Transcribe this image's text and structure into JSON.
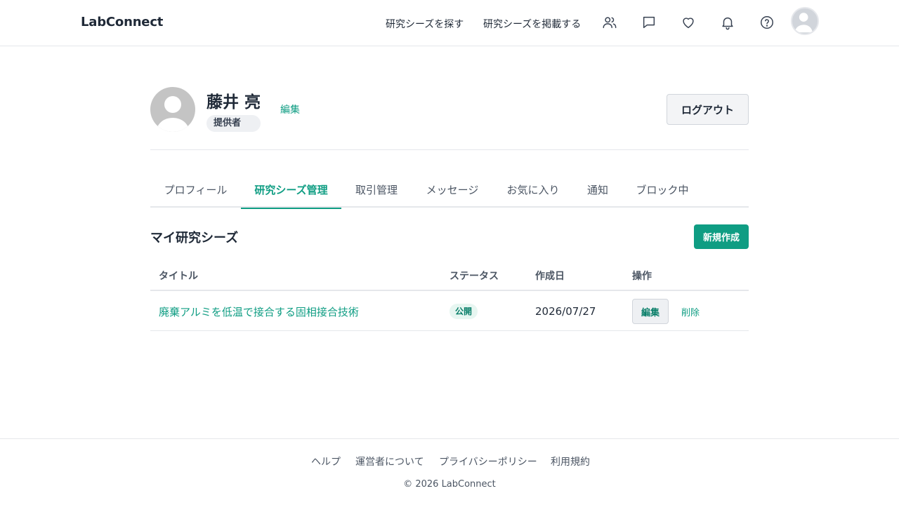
{
  "header": {
    "brand": "LabConnect",
    "nav_find": "研究シーズを探す",
    "nav_post": "研究シーズを掲載する",
    "icons": [
      "users-icon",
      "message-icon",
      "heart-icon",
      "bell-icon",
      "help-icon"
    ]
  },
  "profile": {
    "name": "藤井 亮",
    "role": "提供者",
    "edit_label": "編集",
    "logout_label": "ログアウト"
  },
  "tabs": [
    {
      "label": "プロフィール",
      "active": false
    },
    {
      "label": "研究シーズ管理",
      "active": true
    },
    {
      "label": "取引管理",
      "active": false
    },
    {
      "label": "メッセージ",
      "active": false
    },
    {
      "label": "お気に入り",
      "active": false
    },
    {
      "label": "通知",
      "active": false
    },
    {
      "label": "ブロック中",
      "active": false
    }
  ],
  "section": {
    "title": "マイ研究シーズ",
    "new_label": "新規作成"
  },
  "table": {
    "headers": [
      "タイトル",
      "ステータス",
      "作成日",
      "操作"
    ],
    "rows": [
      {
        "title": "廃棄アルミを低温で接合する固相接合技術",
        "status": "公開",
        "created": "2026/07/27",
        "edit_label": "編集",
        "delete_label": "削除"
      }
    ]
  },
  "footer": {
    "links": [
      "ヘルプ",
      "運営者について",
      "プライバシーポリシー",
      "利用規約"
    ],
    "copyright": "© 2026 LabConnect"
  },
  "colors": {
    "accent": "#0f9d83",
    "text": "#1f2937",
    "border": "#e5e7eb"
  }
}
